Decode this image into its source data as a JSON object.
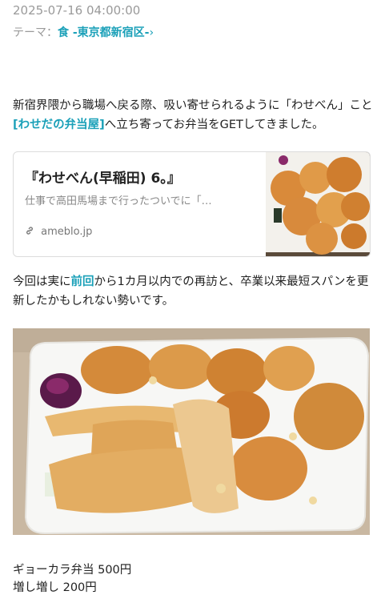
{
  "post": {
    "date": "2025-07-16 04:00:00",
    "theme_label": "テーマ：",
    "theme_link": "食 -東京都新宿区-",
    "theme_chevron": "›"
  },
  "body": {
    "p1_before": "新宿界隈から職場へ戻る際、吸い寄せられるように「わせべん」こと",
    "p1_link": "[わせだの弁当屋]",
    "p1_after": "へ立ち寄ってお弁当をGETしてきました。",
    "p2_before": "今回は実に",
    "p2_link": "前回",
    "p2_after": "から1カ月以内での再訪と、卒業以来最短スパンを更新したかもしれない勢いです。"
  },
  "link_card": {
    "title": "『わせべん(早稲田) 6。』",
    "description": "仕事で高田馬場まで行ったついでに「…",
    "domain": "ameblo.jp",
    "domain_icon": "link-icon"
  },
  "menu": {
    "line1": "ギョーカラ弁当 500円",
    "line2": "増し増し 200円"
  },
  "colors": {
    "accent": "#1aa0b8",
    "meta_gray": "#9a9a9a"
  }
}
